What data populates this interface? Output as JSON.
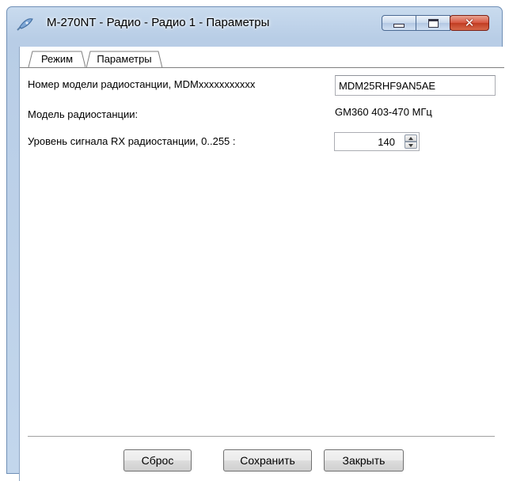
{
  "window": {
    "title": "M-270NT - Радио - Радио 1 - Параметры",
    "icon": "satellite-dish-icon"
  },
  "tabs": [
    {
      "label": "Режим",
      "active": false
    },
    {
      "label": "Параметры",
      "active": true
    }
  ],
  "form": {
    "model_number": {
      "label": "Номер модели радиостанции, MDMxxxxxxxxxxx",
      "value": "MDM25RHF9AN5AE"
    },
    "model": {
      "label": "Модель радиостанции:",
      "value": "GM360 403-470 МГц"
    },
    "rx_level": {
      "label": "Уровень сигнала RX радиостанции, 0..255 :",
      "value": "140"
    }
  },
  "buttons": {
    "reset": "Сброс",
    "save": "Сохранить",
    "close": "Закрыть"
  },
  "colors": {
    "frame": "#c2d6ec",
    "close_button": "#c13c22"
  }
}
